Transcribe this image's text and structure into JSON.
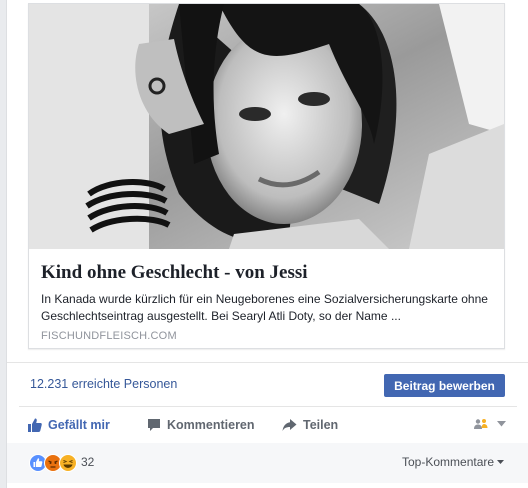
{
  "link_preview": {
    "image_alt": "",
    "title": "Kind ohne Geschlecht - von Jessi",
    "description": "In Kanada wurde kürzlich für ein Neugeborenes eine Sozialversicherungskarte ohne Geschlechtseintrag ausgestellt. Bei Searyl Atli Doty, so der Name ...",
    "domain": "FISCHUNDFLEISCH.COM"
  },
  "reach": {
    "people_reached": "12.231 erreichte Personen",
    "boost_button": "Beitrag bewerben"
  },
  "actions": {
    "like": "Gefällt mir",
    "comment": "Kommentieren",
    "share": "Teilen",
    "like_icon": "thumbs-up-icon",
    "comment_icon": "speech-bubble-icon",
    "share_icon": "share-arrow-icon",
    "audience_icon": "friends-audience-icon"
  },
  "reactions": {
    "count": "32",
    "types": [
      "like",
      "angry",
      "haha"
    ],
    "colors": {
      "like": "#5890ff",
      "angry": "#e9710f",
      "haha": "#f7b125"
    }
  },
  "comments_filter": {
    "label": "Top-Kommentare"
  },
  "colors": {
    "link": "#365899",
    "primary_button": "#4267b2",
    "secondary_text": "#616770",
    "meta_text": "#90949c"
  }
}
